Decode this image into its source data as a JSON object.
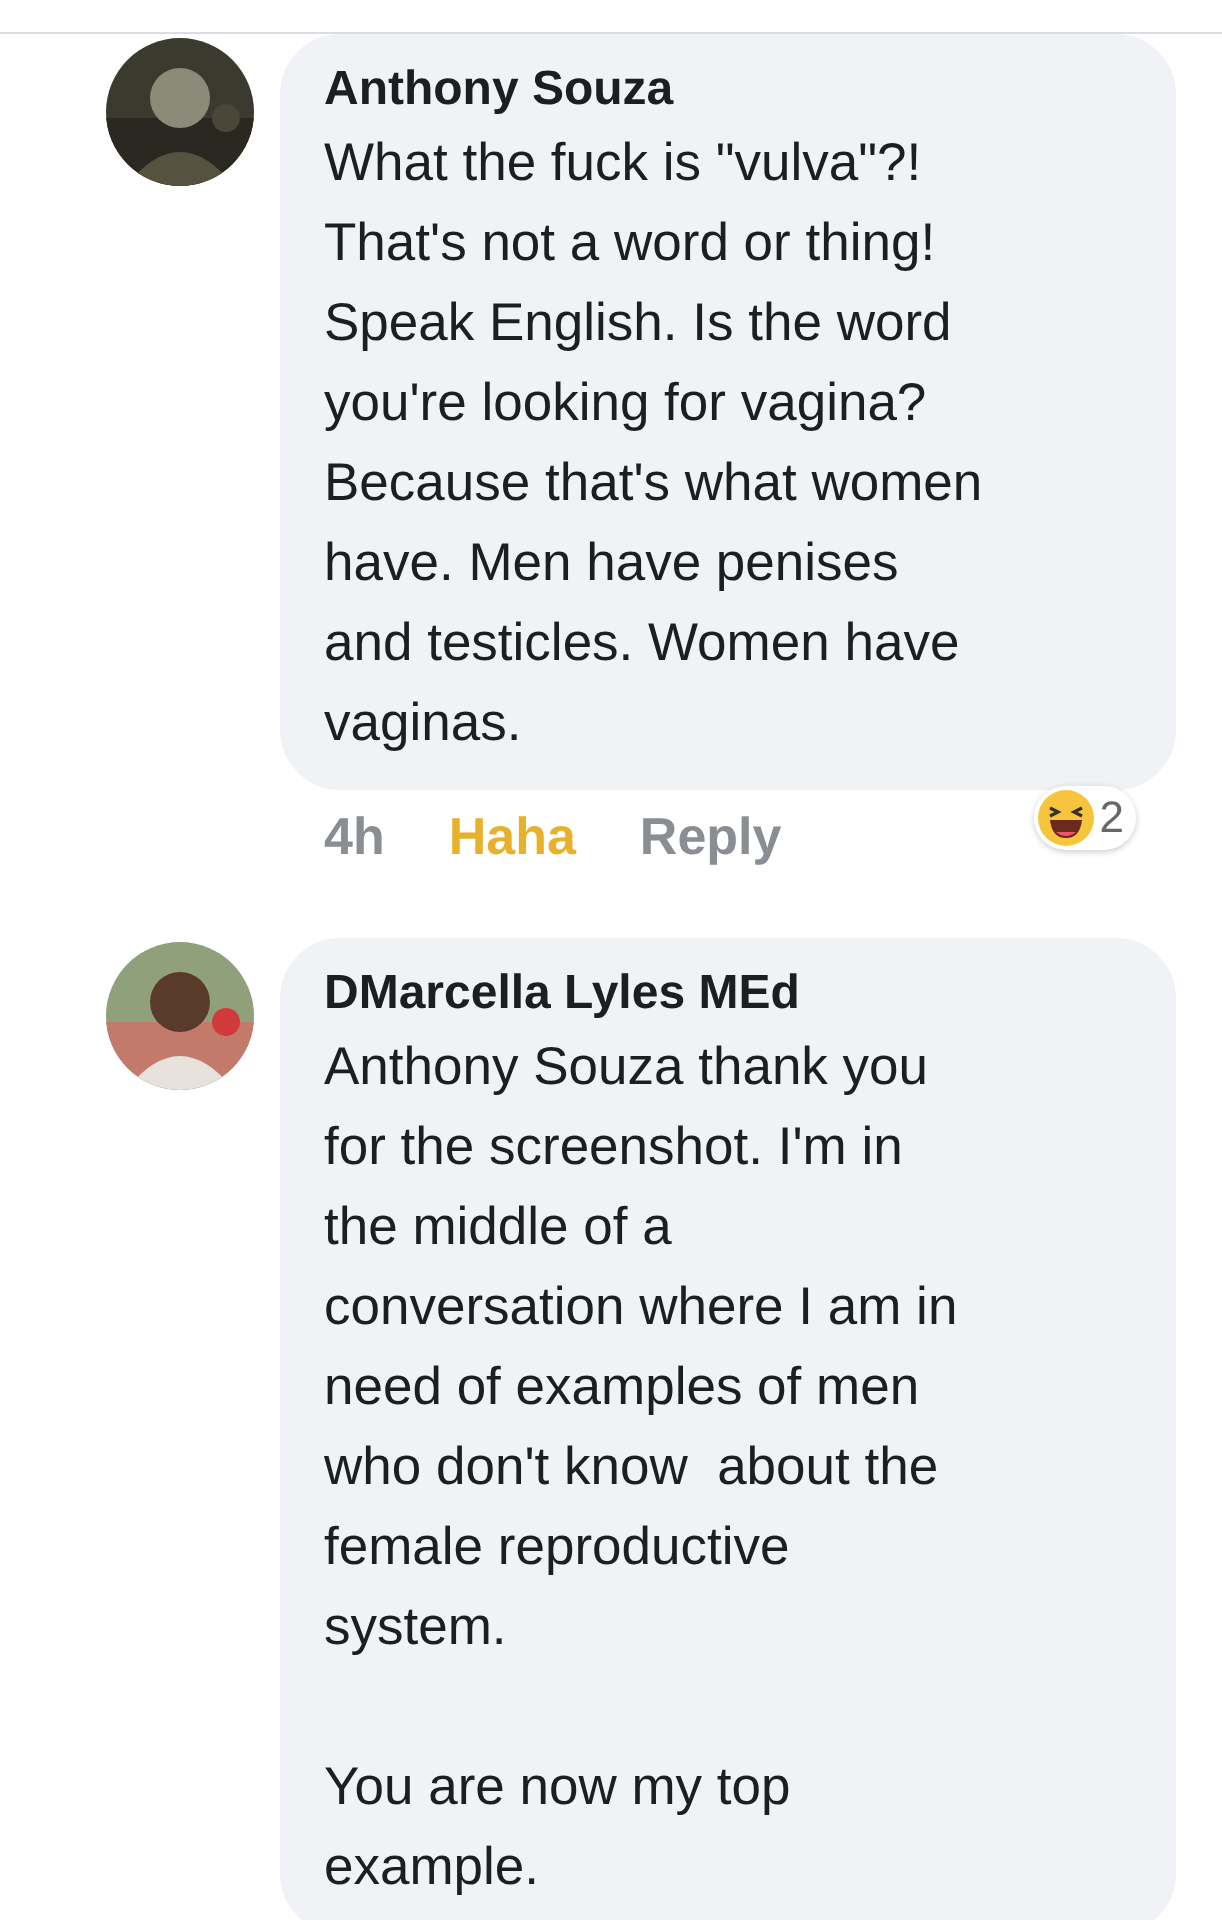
{
  "comments": [
    {
      "author": "Anthony Souza",
      "text": "What the fuck is \"vulva\"?!\nThat's not a word or thing!\nSpeak English. Is the word\nyou're looking for vagina?\nBecause that's what women\nhave. Men have penises\nand testicles. Women have\nvaginas.",
      "time": "4h",
      "reaction": {
        "label": "Haha",
        "selected": true
      },
      "reply": "Reply",
      "reaction_count": "2"
    },
    {
      "author": "DMarcella Lyles MEd",
      "text": "Anthony Souza thank you\nfor the screenshot. I'm in\nthe middle of a\nconversation where I am in\nneed of examples of men\nwho don't know  about the\nfemale reproductive\nsystem.\n\nYou are now my top\nexample."
    }
  ]
}
